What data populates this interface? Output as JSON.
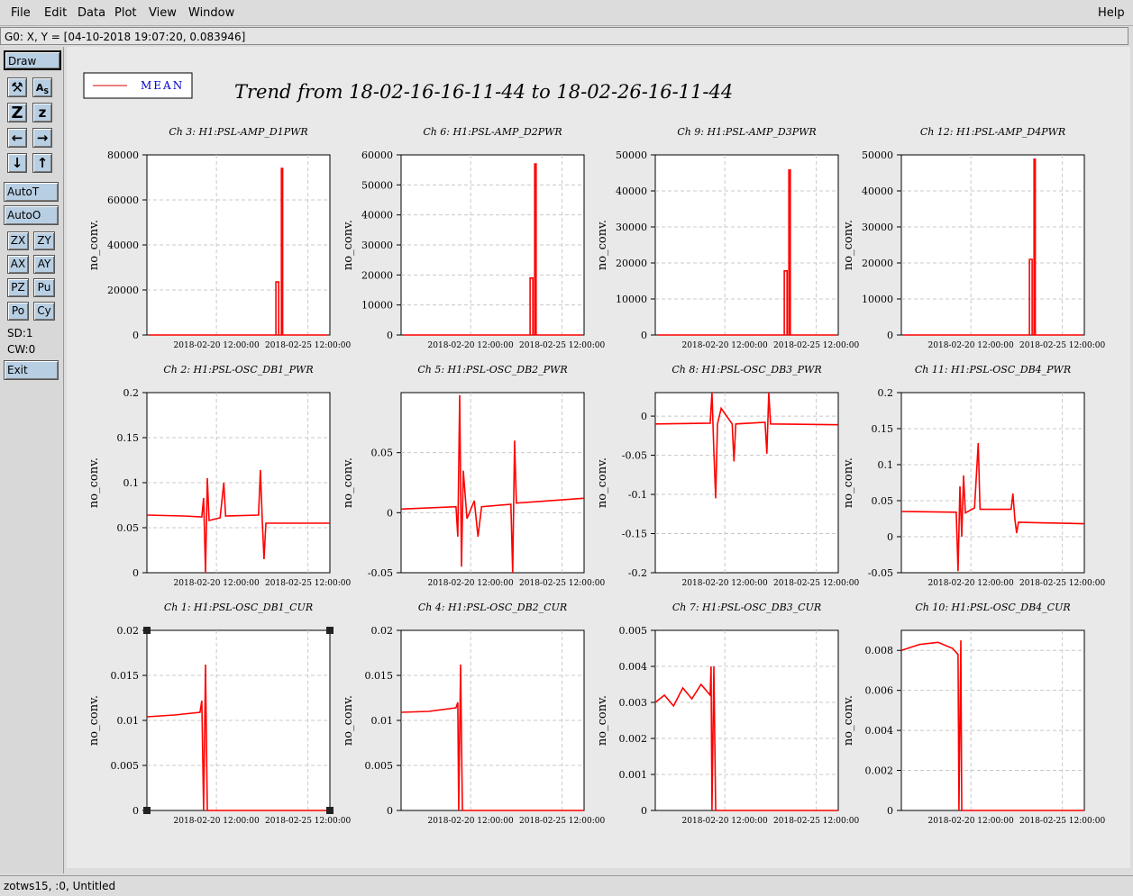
{
  "menu": {
    "items": [
      "File",
      "Edit",
      "Data",
      "Plot",
      "View",
      "Window"
    ],
    "help": "Help"
  },
  "status": {
    "coords": "G0: X, Y = [04-10-2018 19:07:20, 0.083946]"
  },
  "toolbar": {
    "draw": "Draw",
    "icons": [
      "magnify-icon",
      "text-icon",
      "zoom-z-icon",
      "zoom-z-small-icon",
      "arrow-left-icon",
      "arrow-right-icon",
      "arrow-down-icon",
      "arrow-up-icon"
    ],
    "autot": "AutoT",
    "autoo": "AutoO",
    "small_buttons": [
      "ZX",
      "ZY",
      "AX",
      "AY",
      "PZ",
      "Pu",
      "Po",
      "Cy"
    ],
    "sd": "SD:1",
    "cw": "CW:0",
    "exit": "Exit"
  },
  "footer": {
    "text": "zotws15, :0, Untitled"
  },
  "legend": {
    "label": "MEAN",
    "line_color": "#dd0000",
    "text_color": "#0000cc"
  },
  "plot_title": "Trend from 18-02-16-16-11-44 to 18-02-26-16-11-44",
  "colors": {
    "trace": "#ff0000",
    "canvas": "#e9e9e9",
    "button": "#b8cfe3"
  },
  "chart_data": [
    {
      "type": "line",
      "title": "Ch 3: H1:PSL-AMP_D1PWR",
      "ylabel": "no_conv.",
      "ylim": [
        0,
        80000
      ],
      "yticks": [
        0,
        20000,
        40000,
        60000,
        80000
      ],
      "xticks": [
        "2018-02-20 12:00:00",
        "2018-02-25 12:00:00"
      ],
      "series": [
        {
          "values": [
            [
              0.1,
              0
            ],
            [
              7.05,
              0
            ],
            [
              7.05,
              23600
            ],
            [
              7.2,
              23600
            ],
            [
              7.2,
              0
            ],
            [
              7.35,
              0
            ],
            [
              7.35,
              74000
            ],
            [
              7.42,
              74000
            ],
            [
              7.42,
              0
            ],
            [
              9.9,
              0
            ]
          ]
        }
      ]
    },
    {
      "type": "line",
      "title": "Ch 6: H1:PSL-AMP_D2PWR",
      "ylabel": "no_conv.",
      "ylim": [
        0,
        60000
      ],
      "yticks": [
        0,
        10000,
        20000,
        30000,
        40000,
        50000,
        60000
      ],
      "xticks": [
        "2018-02-20 12:00:00",
        "2018-02-25 12:00:00"
      ],
      "series": [
        {
          "values": [
            [
              0.1,
              0
            ],
            [
              7.05,
              0
            ],
            [
              7.05,
              19000
            ],
            [
              7.2,
              19000
            ],
            [
              7.2,
              0
            ],
            [
              7.3,
              0
            ],
            [
              7.3,
              57000
            ],
            [
              7.38,
              57000
            ],
            [
              7.38,
              0
            ],
            [
              9.9,
              0
            ]
          ]
        }
      ]
    },
    {
      "type": "line",
      "title": "Ch 9: H1:PSL-AMP_D3PWR",
      "ylabel": "no_conv.",
      "ylim": [
        0,
        50000
      ],
      "yticks": [
        0,
        10000,
        20000,
        30000,
        40000,
        50000
      ],
      "xticks": [
        "2018-02-20 12:00:00",
        "2018-02-25 12:00:00"
      ],
      "series": [
        {
          "values": [
            [
              0.1,
              0
            ],
            [
              7.05,
              0
            ],
            [
              7.05,
              17800
            ],
            [
              7.2,
              17800
            ],
            [
              7.2,
              0
            ],
            [
              7.3,
              0
            ],
            [
              7.3,
              45800
            ],
            [
              7.38,
              45800
            ],
            [
              7.38,
              0
            ],
            [
              9.9,
              0
            ]
          ]
        }
      ]
    },
    {
      "type": "line",
      "title": "Ch 12: H1:PSL-AMP_D4PWR",
      "ylabel": "no_conv.",
      "ylim": [
        0,
        50000
      ],
      "yticks": [
        0,
        10000,
        20000,
        30000,
        40000,
        50000
      ],
      "xticks": [
        "2018-02-20 12:00:00",
        "2018-02-25 12:00:00"
      ],
      "series": [
        {
          "values": [
            [
              0.1,
              0
            ],
            [
              7.0,
              0
            ],
            [
              7.0,
              21000
            ],
            [
              7.15,
              21000
            ],
            [
              7.15,
              0
            ],
            [
              7.25,
              0
            ],
            [
              7.25,
              48800
            ],
            [
              7.32,
              48800
            ],
            [
              7.32,
              0
            ],
            [
              9.9,
              0
            ]
          ]
        }
      ]
    },
    {
      "type": "line",
      "title": "Ch 2: H1:PSL-OSC_DB1_PWR",
      "ylabel": "no_conv.",
      "ylim": [
        0,
        0.2
      ],
      "yticks": [
        0,
        0.05,
        0.1,
        0.15,
        0.2
      ],
      "xticks": [
        "2018-02-20 12:00:00",
        "2018-02-25 12:00:00"
      ],
      "series": [
        {
          "values": [
            [
              0,
              0.064
            ],
            [
              2.0,
              0.063
            ],
            [
              3.0,
              0.062
            ],
            [
              3.1,
              0.083
            ],
            [
              3.2,
              0.0
            ],
            [
              3.3,
              0.105
            ],
            [
              3.4,
              0.058
            ],
            [
              4.0,
              0.061
            ],
            [
              4.2,
              0.1
            ],
            [
              4.3,
              0.063
            ],
            [
              6.1,
              0.064
            ],
            [
              6.2,
              0.114
            ],
            [
              6.3,
              0.06
            ],
            [
              6.4,
              0.015
            ],
            [
              6.5,
              0.055
            ],
            [
              10,
              0.055
            ]
          ]
        }
      ]
    },
    {
      "type": "line",
      "title": "Ch 5: H1:PSL-OSC_DB2_PWR",
      "ylabel": "no_conv.",
      "ylim": [
        -0.05,
        0.1
      ],
      "yticks": [
        -0.05,
        0,
        0.05
      ],
      "xticks": [
        "2018-02-20 12:00:00",
        "2018-02-25 12:00:00"
      ],
      "series": [
        {
          "values": [
            [
              0,
              0.003
            ],
            [
              3.0,
              0.005
            ],
            [
              3.1,
              -0.02
            ],
            [
              3.2,
              0.098
            ],
            [
              3.3,
              -0.045
            ],
            [
              3.4,
              0.035
            ],
            [
              3.6,
              -0.005
            ],
            [
              4.0,
              0.01
            ],
            [
              4.2,
              -0.02
            ],
            [
              4.4,
              0.005
            ],
            [
              6.0,
              0.007
            ],
            [
              6.1,
              -0.05
            ],
            [
              6.2,
              0.06
            ],
            [
              6.3,
              0.008
            ],
            [
              10,
              0.012
            ]
          ]
        }
      ]
    },
    {
      "type": "line",
      "title": "Ch 8: H1:PSL-OSC_DB3_PWR",
      "ylabel": "no_conv.",
      "ylim": [
        -0.2,
        0.03
      ],
      "yticks": [
        -0.2,
        -0.15,
        -0.1,
        -0.05,
        0
      ],
      "xticks": [
        "2018-02-20 12:00:00",
        "2018-02-25 12:00:00"
      ],
      "series": [
        {
          "values": [
            [
              0,
              -0.01
            ],
            [
              3.0,
              -0.009
            ],
            [
              3.1,
              0.03
            ],
            [
              3.2,
              -0.045
            ],
            [
              3.3,
              -0.105
            ],
            [
              3.4,
              -0.01
            ],
            [
              3.6,
              0.01
            ],
            [
              4.2,
              -0.01
            ],
            [
              4.3,
              -0.058
            ],
            [
              4.4,
              -0.01
            ],
            [
              6.0,
              -0.008
            ],
            [
              6.1,
              -0.048
            ],
            [
              6.2,
              0.033
            ],
            [
              6.3,
              -0.01
            ],
            [
              10,
              -0.011
            ]
          ]
        }
      ]
    },
    {
      "type": "line",
      "title": "Ch 11: H1:PSL-OSC_DB4_PWR",
      "ylabel": "no_conv.",
      "ylim": [
        -0.05,
        0.2
      ],
      "yticks": [
        -0.05,
        0,
        0.05,
        0.1,
        0.15,
        0.2
      ],
      "xticks": [
        "2018-02-20 12:00:00",
        "2018-02-25 12:00:00"
      ],
      "series": [
        {
          "values": [
            [
              0,
              0.035
            ],
            [
              3.0,
              0.034
            ],
            [
              3.1,
              -0.048
            ],
            [
              3.2,
              0.07
            ],
            [
              3.3,
              0.0
            ],
            [
              3.4,
              0.085
            ],
            [
              3.5,
              0.033
            ],
            [
              4.0,
              0.04
            ],
            [
              4.2,
              0.13
            ],
            [
              4.3,
              0.038
            ],
            [
              6.0,
              0.038
            ],
            [
              6.1,
              0.06
            ],
            [
              6.2,
              0.025
            ],
            [
              6.3,
              0.005
            ],
            [
              6.4,
              0.02
            ],
            [
              10,
              0.018
            ]
          ]
        }
      ]
    },
    {
      "type": "line",
      "title": "Ch 1: H1:PSL-OSC_DB1_CUR",
      "ylabel": "no_conv.",
      "ylim": [
        0,
        0.02
      ],
      "yticks": [
        0,
        0.005,
        0.01,
        0.015,
        0.02
      ],
      "xticks": [
        "2018-02-20 12:00:00",
        "2018-02-25 12:00:00"
      ],
      "series": [
        {
          "values": [
            [
              0,
              0.0104
            ],
            [
              1.5,
              0.0106
            ],
            [
              2.9,
              0.0109
            ],
            [
              3.0,
              0.0122
            ],
            [
              3.1,
              0.0
            ],
            [
              3.2,
              0.0162
            ],
            [
              3.3,
              0.0
            ],
            [
              3.35,
              0
            ],
            [
              10,
              0
            ]
          ]
        }
      ]
    },
    {
      "type": "line",
      "title": "Ch 4: H1:PSL-OSC_DB2_CUR",
      "ylabel": "no_conv.",
      "ylim": [
        0,
        0.02
      ],
      "yticks": [
        0,
        0.005,
        0.01,
        0.015,
        0.02
      ],
      "xticks": [
        "2018-02-20 12:00:00",
        "2018-02-25 12:00:00"
      ],
      "series": [
        {
          "values": [
            [
              0,
              0.0109
            ],
            [
              1.5,
              0.011
            ],
            [
              3.0,
              0.0114
            ],
            [
              3.1,
              0.012
            ],
            [
              3.15,
              0.0
            ],
            [
              3.25,
              0.0162
            ],
            [
              3.35,
              0.0
            ],
            [
              10,
              0
            ]
          ]
        }
      ]
    },
    {
      "type": "line",
      "title": "Ch 7: H1:PSL-OSC_DB3_CUR",
      "ylabel": "no_conv.",
      "ylim": [
        0,
        0.005
      ],
      "yticks": [
        0,
        0.001,
        0.002,
        0.003,
        0.004,
        0.005
      ],
      "xticks": [
        "2018-02-20 12:00:00",
        "2018-02-25 12:00:00"
      ],
      "series": [
        {
          "values": [
            [
              0,
              0.003
            ],
            [
              0.5,
              0.0032
            ],
            [
              1.0,
              0.0029
            ],
            [
              1.5,
              0.0034
            ],
            [
              2.0,
              0.0031
            ],
            [
              2.5,
              0.0035
            ],
            [
              3.0,
              0.0032
            ],
            [
              3.05,
              0.004
            ],
            [
              3.1,
              0.0
            ],
            [
              3.2,
              0.004
            ],
            [
              3.3,
              0.0
            ],
            [
              10,
              0
            ]
          ]
        }
      ]
    },
    {
      "type": "line",
      "title": "Ch 10: H1:PSL-OSC_DB4_CUR",
      "ylabel": "no_conv.",
      "ylim": [
        0,
        0.009
      ],
      "yticks": [
        0,
        0.002,
        0.004,
        0.006,
        0.008
      ],
      "xticks": [
        "2018-02-20 12:00:00",
        "2018-02-25 12:00:00"
      ],
      "series": [
        {
          "values": [
            [
              0,
              0.008
            ],
            [
              1.0,
              0.0083
            ],
            [
              2.0,
              0.0084
            ],
            [
              2.8,
              0.0081
            ],
            [
              3.1,
              0.0078
            ],
            [
              3.15,
              0.0
            ],
            [
              3.25,
              0.0085
            ],
            [
              3.3,
              0.0
            ],
            [
              10,
              0
            ]
          ]
        }
      ]
    }
  ]
}
